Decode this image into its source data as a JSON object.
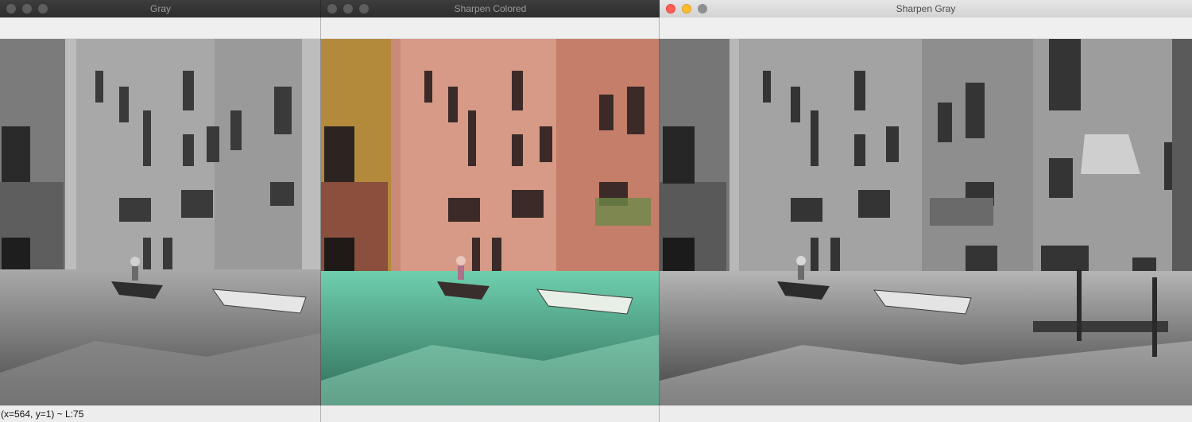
{
  "windows": [
    {
      "title": "Gray",
      "status": "(x=564, y=1) ~ L:75",
      "style": "gray"
    },
    {
      "title": "Sharpen Colored",
      "status": "",
      "style": "color"
    },
    {
      "title": "Sharpen Gray",
      "status": "",
      "style": "gray"
    }
  ],
  "icons": {
    "close": "close-icon",
    "minimize": "minimize-icon",
    "zoom": "zoom-icon"
  },
  "colors": {
    "active_close": "#ff5f57",
    "active_minimize": "#febc2e",
    "inactive_light": "#5e5e5e",
    "water_tint": "#5fc7a6",
    "brick_tint": "#d08a78"
  }
}
